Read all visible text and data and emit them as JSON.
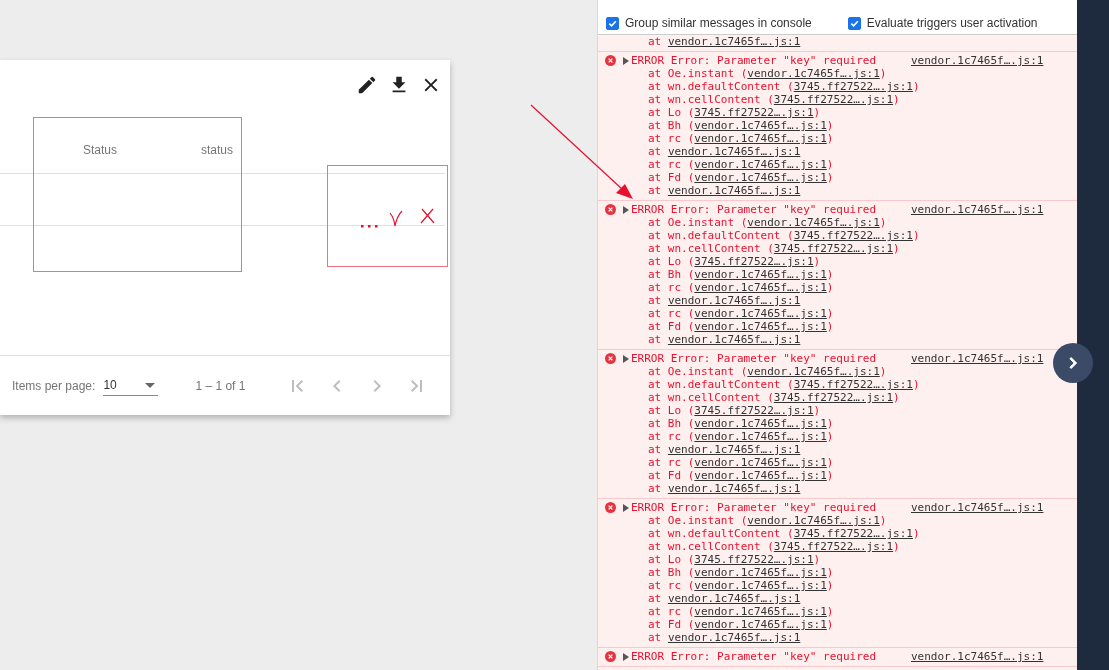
{
  "dialog": {
    "columns": [
      "Status",
      "status"
    ],
    "rows": [
      {
        "cells": [
          "",
          ""
        ]
      }
    ],
    "paginator": {
      "label": "Items per page:",
      "page_size": "10",
      "range": "1 – 1 of 1",
      "nav": [
        {
          "kind": "first",
          "disabled": true
        },
        {
          "kind": "prev",
          "disabled": true
        },
        {
          "kind": "next",
          "disabled": true
        },
        {
          "kind": "last",
          "disabled": true
        }
      ]
    }
  },
  "console": {
    "settings": [
      {
        "label": "Group similar messages in console",
        "checked": true
      },
      {
        "label": "Evaluate triggers user activation",
        "checked": true
      }
    ],
    "messages": [
      {
        "frames": [
          {
            "text": "at ",
            "link": "vendor.1c7465f….js:1"
          }
        ]
      },
      {
        "message": "ERROR Error: Parameter \"key\" required",
        "source": "vendor.1c7465f….js:1",
        "frames": [
          {
            "text": "at Oe.instant (",
            "link": "vendor.1c7465f….js:1",
            "end": ")"
          },
          {
            "text": "at wn.defaultContent (",
            "link": "3745.ff27522….js:1",
            "end": ")"
          },
          {
            "text": "at wn.cellContent (",
            "link": "3745.ff27522….js:1",
            "end": ")"
          },
          {
            "text": "at Lo (",
            "link": "3745.ff27522….js:1",
            "end": ")"
          },
          {
            "text": "at Bh (",
            "link": "vendor.1c7465f….js:1",
            "end": ")"
          },
          {
            "text": "at rc (",
            "link": "vendor.1c7465f….js:1",
            "end": ")"
          },
          {
            "text": "at ",
            "link": "vendor.1c7465f….js:1"
          },
          {
            "text": "at rc (",
            "link": "vendor.1c7465f….js:1",
            "end": ")"
          },
          {
            "text": "at Fd (",
            "link": "vendor.1c7465f….js:1",
            "end": ")"
          },
          {
            "text": "at ",
            "link": "vendor.1c7465f….js:1"
          }
        ]
      },
      {
        "message": "ERROR Error: Parameter \"key\" required",
        "source": "vendor.1c7465f….js:1",
        "frames": [
          {
            "text": "at Oe.instant (",
            "link": "vendor.1c7465f….js:1",
            "end": ")"
          },
          {
            "text": "at wn.defaultContent (",
            "link": "3745.ff27522….js:1",
            "end": ")"
          },
          {
            "text": "at wn.cellContent (",
            "link": "3745.ff27522….js:1",
            "end": ")"
          },
          {
            "text": "at Lo (",
            "link": "3745.ff27522….js:1",
            "end": ")"
          },
          {
            "text": "at Bh (",
            "link": "vendor.1c7465f….js:1",
            "end": ")"
          },
          {
            "text": "at rc (",
            "link": "vendor.1c7465f….js:1",
            "end": ")"
          },
          {
            "text": "at ",
            "link": "vendor.1c7465f….js:1"
          },
          {
            "text": "at rc (",
            "link": "vendor.1c7465f….js:1",
            "end": ")"
          },
          {
            "text": "at Fd (",
            "link": "vendor.1c7465f….js:1",
            "end": ")"
          },
          {
            "text": "at ",
            "link": "vendor.1c7465f….js:1"
          }
        ]
      },
      {
        "message": "ERROR Error: Parameter \"key\" required",
        "source": "vendor.1c7465f….js:1",
        "frames": [
          {
            "text": "at Oe.instant (",
            "link": "vendor.1c7465f….js:1",
            "end": ")"
          },
          {
            "text": "at wn.defaultContent (",
            "link": "3745.ff27522….js:1",
            "end": ")"
          },
          {
            "text": "at wn.cellContent (",
            "link": "3745.ff27522….js:1",
            "end": ")"
          },
          {
            "text": "at Lo (",
            "link": "3745.ff27522….js:1",
            "end": ")"
          },
          {
            "text": "at Bh (",
            "link": "vendor.1c7465f….js:1",
            "end": ")"
          },
          {
            "text": "at rc (",
            "link": "vendor.1c7465f….js:1",
            "end": ")"
          },
          {
            "text": "at ",
            "link": "vendor.1c7465f….js:1"
          },
          {
            "text": "at rc (",
            "link": "vendor.1c7465f….js:1",
            "end": ")"
          },
          {
            "text": "at Fd (",
            "link": "vendor.1c7465f….js:1",
            "end": ")"
          },
          {
            "text": "at ",
            "link": "vendor.1c7465f….js:1"
          }
        ]
      },
      {
        "message": "ERROR Error: Parameter \"key\" required",
        "source": "vendor.1c7465f….js:1",
        "frames": [
          {
            "text": "at Oe.instant (",
            "link": "vendor.1c7465f….js:1",
            "end": ")"
          },
          {
            "text": "at wn.defaultContent (",
            "link": "3745.ff27522….js:1",
            "end": ")"
          },
          {
            "text": "at wn.cellContent (",
            "link": "3745.ff27522….js:1",
            "end": ")"
          },
          {
            "text": "at Lo (",
            "link": "3745.ff27522….js:1",
            "end": ")"
          },
          {
            "text": "at Bh (",
            "link": "vendor.1c7465f….js:1",
            "end": ")"
          },
          {
            "text": "at rc (",
            "link": "vendor.1c7465f….js:1",
            "end": ")"
          },
          {
            "text": "at ",
            "link": "vendor.1c7465f….js:1"
          },
          {
            "text": "at rc (",
            "link": "vendor.1c7465f….js:1",
            "end": ")"
          },
          {
            "text": "at Fd (",
            "link": "vendor.1c7465f….js:1",
            "end": ")"
          },
          {
            "text": "at ",
            "link": "vendor.1c7465f….js:1"
          }
        ]
      },
      {
        "message": "ERROR Error: Parameter \"key\" required",
        "source": "vendor.1c7465f….js:1"
      }
    ]
  }
}
